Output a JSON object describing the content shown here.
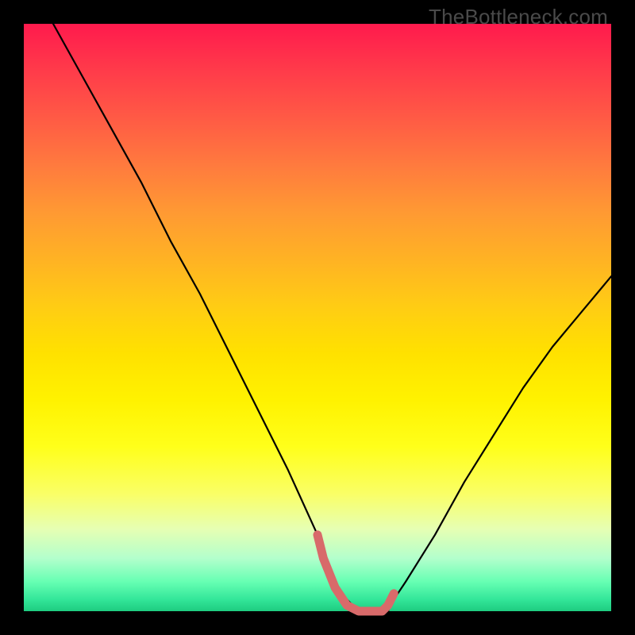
{
  "watermark": "TheBottleneck.com",
  "chart_data": {
    "type": "line",
    "title": "",
    "xlabel": "",
    "ylabel": "",
    "xlim": [
      0,
      100
    ],
    "ylim": [
      0,
      100
    ],
    "grid": false,
    "legend": false,
    "series": [
      {
        "name": "main-curve",
        "color": "#000000",
        "x": [
          5,
          10,
          15,
          20,
          25,
          30,
          35,
          40,
          45,
          50,
          51,
          53,
          55,
          57,
          60,
          62,
          63,
          65,
          70,
          75,
          80,
          85,
          90,
          95,
          100
        ],
        "y": [
          100,
          91,
          82,
          73,
          63,
          54,
          44,
          34,
          24,
          13,
          10,
          5,
          2,
          0,
          0,
          0,
          2,
          5,
          13,
          22,
          30,
          38,
          45,
          51,
          57
        ]
      },
      {
        "name": "highlight-flat",
        "color": "#d86a6a",
        "x": [
          50,
          51,
          53,
          55,
          57,
          59,
          61,
          62,
          63
        ],
        "y": [
          13,
          9,
          4,
          1,
          0,
          0,
          0,
          1,
          3
        ]
      }
    ],
    "background_gradient": {
      "top": "#ff1a4d",
      "middle": "#ffe100",
      "bottom": "#1ecc80"
    }
  }
}
